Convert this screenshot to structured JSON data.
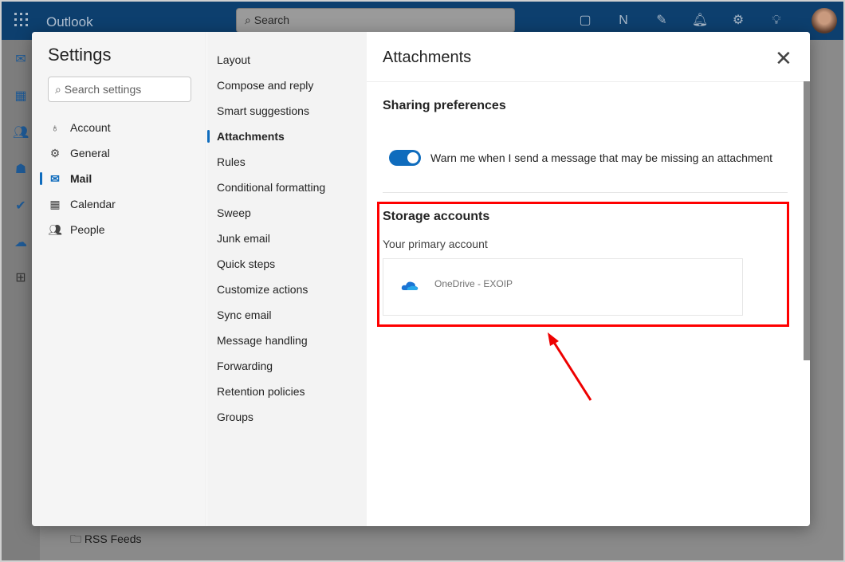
{
  "app": {
    "name": "Outlook",
    "search_placeholder": "Search",
    "folder": "RSS Feeds"
  },
  "settings": {
    "title": "Settings",
    "search_placeholder": "Search settings",
    "categories": [
      {
        "label": "Account",
        "icon": "person-icon"
      },
      {
        "label": "General",
        "icon": "gear-icon"
      },
      {
        "label": "Mail",
        "icon": "mail-icon",
        "selected": true
      },
      {
        "label": "Calendar",
        "icon": "calendar-icon"
      },
      {
        "label": "People",
        "icon": "people-icon"
      }
    ],
    "mail_items": [
      "Layout",
      "Compose and reply",
      "Smart suggestions",
      "Attachments",
      "Rules",
      "Conditional formatting",
      "Sweep",
      "Junk email",
      "Quick steps",
      "Customize actions",
      "Sync email",
      "Message handling",
      "Forwarding",
      "Retention policies",
      "Groups"
    ],
    "selected_mail_item": "Attachments"
  },
  "pane": {
    "title": "Attachments",
    "sharing_heading": "Sharing preferences",
    "warn_toggle_label": "Warn me when I send a message that may be missing an attachment",
    "warn_toggle_on": true,
    "storage_heading": "Storage accounts",
    "primary_label": "Your primary account",
    "account_name": "OneDrive - EXOIP"
  },
  "colors": {
    "accent": "#0f6cbd",
    "highlight": "#ff0000"
  }
}
